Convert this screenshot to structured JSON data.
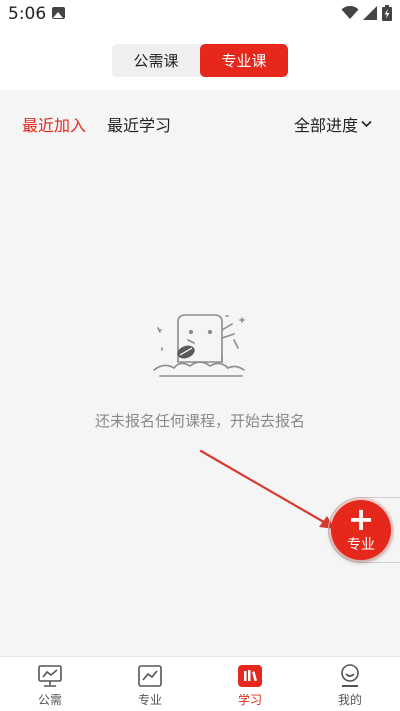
{
  "status_bar": {
    "time": "5:06",
    "photo_icon": "image-icon",
    "wifi_icon": "wifi-icon",
    "signal_icon": "signal-icon",
    "battery_icon": "battery-charging-icon"
  },
  "segment": {
    "tabs": [
      {
        "label": "公需课",
        "active": false
      },
      {
        "label": "专业课",
        "active": true
      }
    ],
    "accent": "#e5271c"
  },
  "filters": {
    "tabs": [
      {
        "label": "最近加入",
        "active": true
      },
      {
        "label": "最近学习",
        "active": false
      }
    ],
    "progress_label": "全部进度",
    "progress_icon": "chevron-down-icon"
  },
  "empty_state": {
    "icon": "empty-box-leaf-icon",
    "message": "还未报名任何课程，开始去报名"
  },
  "fab": {
    "icon": "plus-icon",
    "label": "专业"
  },
  "tabbar": {
    "items": [
      {
        "label": "公需",
        "icon": "monitor-icon",
        "active": false
      },
      {
        "label": "专业",
        "icon": "chart-icon",
        "active": false
      },
      {
        "label": "学习",
        "icon": "books-icon",
        "active": true
      },
      {
        "label": "我的",
        "icon": "profile-icon",
        "active": false
      }
    ]
  }
}
